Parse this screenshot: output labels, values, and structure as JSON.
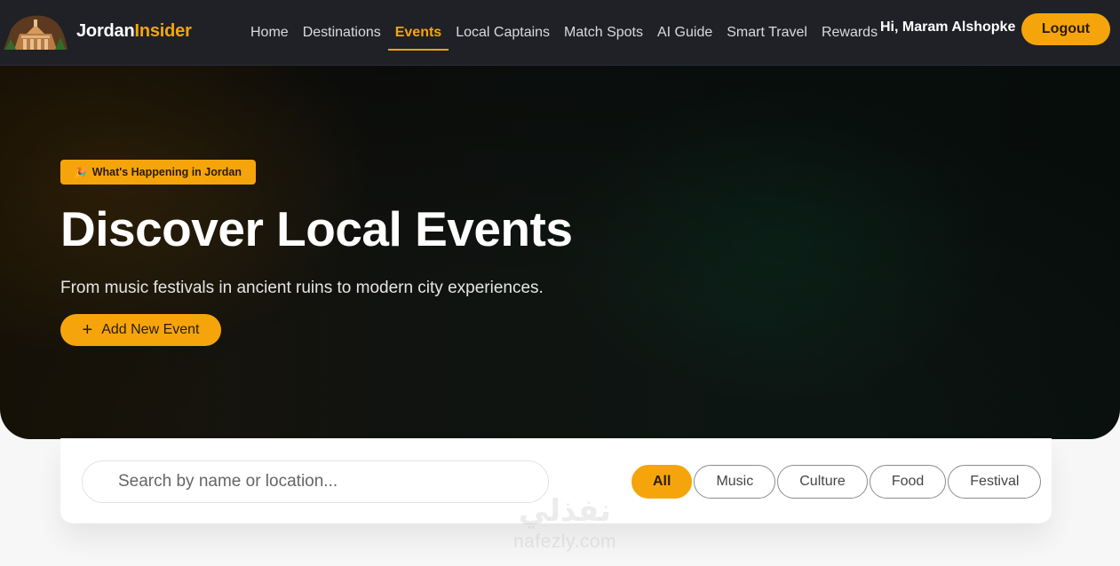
{
  "navbar": {
    "brand": {
      "name_part1": "Jordan",
      "name_part2": "Insider",
      "logo_icon": "petra-treasury-logo"
    },
    "links": [
      {
        "label": "Home",
        "active": false
      },
      {
        "label": "Destinations",
        "active": false
      },
      {
        "label": "Events",
        "active": true
      },
      {
        "label": "Local Captains",
        "active": false
      },
      {
        "label": "Match Spots",
        "active": false
      },
      {
        "label": "AI Guide",
        "active": false
      },
      {
        "label": "Smart Travel",
        "active": false
      },
      {
        "label": "Rewards",
        "active": false
      }
    ],
    "greeting": "Hi, Maram Alshopke",
    "logout_label": "Logout"
  },
  "hero": {
    "badge_icon": "party-popper-icon",
    "badge_glyph": "🎉",
    "badge_text": "What's Happening in Jordan",
    "title": "Discover Local Events",
    "subtitle": "From music festivals in ancient ruins to modern city experiences.",
    "add_button": {
      "icon_glyph": "+",
      "label": "Add New Event"
    }
  },
  "filters": {
    "search_placeholder": "Search by name or location...",
    "categories": [
      {
        "label": "All",
        "active": true
      },
      {
        "label": "Music",
        "active": false
      },
      {
        "label": "Culture",
        "active": false
      },
      {
        "label": "Food",
        "active": false
      },
      {
        "label": "Festival",
        "active": false
      }
    ]
  },
  "watermark": {
    "arabic": "نفذلي",
    "latin": "nafezly.com"
  },
  "colors": {
    "accent": "#f5a50b",
    "navbar_bg": "#1f2127",
    "hero_bg": "#111310",
    "page_bg": "#f7f7f8"
  }
}
